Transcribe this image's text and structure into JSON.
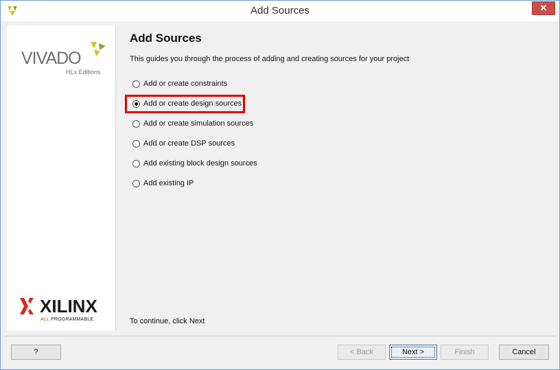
{
  "window": {
    "title": "Add Sources",
    "close_label": "✕"
  },
  "sidebar": {
    "brand_name": "VIVADO",
    "brand_edition": "HLx Editions",
    "company_name": "XILINX",
    "company_tagline_prefix": "ALL",
    "company_tagline_suffix": "PROGRAMMABLE."
  },
  "page": {
    "heading": "Add Sources",
    "description": "This guides you through the process of adding and creating sources for your project",
    "options": [
      {
        "label": "Add or create constraints",
        "selected": false
      },
      {
        "label": "Add or create design sources",
        "selected": true
      },
      {
        "label": "Add or create simulation sources",
        "selected": false
      },
      {
        "label": "Add or create DSP sources",
        "selected": false
      },
      {
        "label": "Add existing block design sources",
        "selected": false
      },
      {
        "label": "Add existing IP",
        "selected": false
      }
    ],
    "footer_note": "To continue, click Next"
  },
  "buttons": {
    "help": "?",
    "back": "< Back",
    "next": "Next >",
    "finish": "Finish",
    "cancel": "Cancel"
  },
  "colors": {
    "highlight": "#e00000",
    "xilinx_red": "#d52b1e",
    "vivado_accent": "#c7c92b"
  }
}
